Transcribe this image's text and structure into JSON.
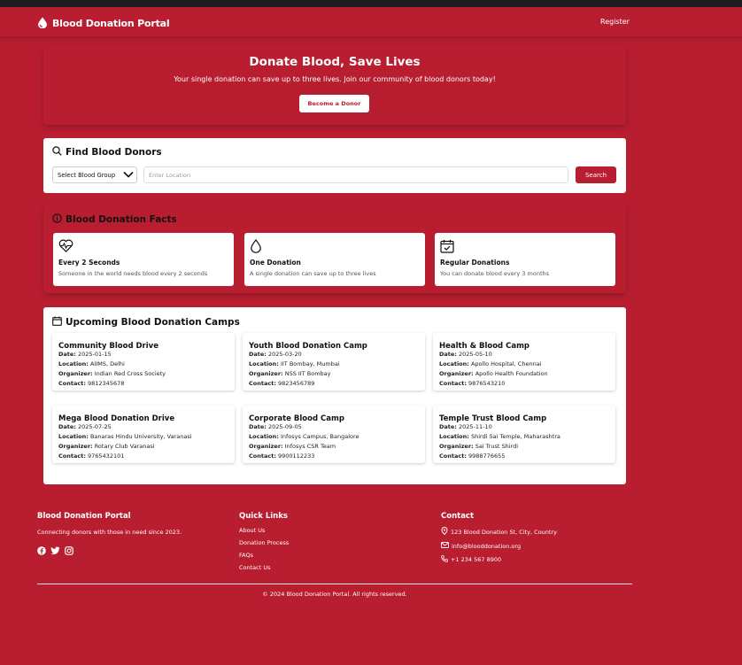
{
  "navbar": {
    "brand": "Blood Donation Portal",
    "register": "Register"
  },
  "hero": {
    "title": "Donate Blood, Save Lives",
    "subtitle": "Your single donation can save up to three lives. Join our community of blood donors today!",
    "button": "Become a Donor"
  },
  "search": {
    "title": "Find Blood Donors",
    "blood_group_selected": "Select Blood Group",
    "location_placeholder": "Enter Location",
    "button": "Search"
  },
  "facts": {
    "title": "Blood Donation Facts",
    "items": [
      {
        "icon": "heartbeat-icon",
        "title": "Every 2 Seconds",
        "desc": "Someone in the world needs blood every 2 seconds"
      },
      {
        "icon": "droplet-icon",
        "title": "One Donation",
        "desc": "A single donation can save up to three lives"
      },
      {
        "icon": "calendar-check-icon",
        "title": "Regular Donations",
        "desc": "You can donate blood every 3 months"
      }
    ]
  },
  "camps": {
    "title": "Upcoming Blood Donation Camps",
    "labels": {
      "date": "Date:",
      "location": "Location:",
      "organizer": "Organizer:",
      "contact": "Contact:"
    },
    "items": [
      {
        "name": "Community Blood Drive",
        "date": "2025-01-15",
        "location": "AIIMS, Delhi",
        "organizer": "Indian Red Cross Society",
        "contact": "9812345678"
      },
      {
        "name": "Youth Blood Donation Camp",
        "date": "2025-03-20",
        "location": "IIT Bombay, Mumbai",
        "organizer": "NSS IIT Bombay",
        "contact": "9823456789"
      },
      {
        "name": "Health & Blood Camp",
        "date": "2025-05-10",
        "location": "Apollo Hospital, Chennai",
        "organizer": "Apollo Health Foundation",
        "contact": "9876543210"
      },
      {
        "name": "Mega Blood Donation Drive",
        "date": "2025-07-25",
        "location": "Banaras Hindu University, Varanasi",
        "organizer": "Rotary Club Varanasi",
        "contact": "9765432101"
      },
      {
        "name": "Corporate Blood Camp",
        "date": "2025-09-05",
        "location": "Infosys Campus, Bangalore",
        "organizer": "Infosys CSR Team",
        "contact": "9900112233"
      },
      {
        "name": "Temple Trust Blood Camp",
        "date": "2025-11-10",
        "location": "Shirdi Sai Temple, Maharashtra",
        "organizer": "Sai Trust Shirdi",
        "contact": "9988776655"
      }
    ]
  },
  "footer": {
    "about_title": "Blood Donation Portal",
    "tagline": "Connecting donors with those in need since 2023.",
    "links_title": "Quick Links",
    "links": [
      "About Us",
      "Donation Process",
      "FAQs",
      "Contact Us"
    ],
    "contact_title": "Contact",
    "address": "123 Blood Donation St, City, Country",
    "email": "info@blooddonation.org",
    "phone": "+1 234 567 8900",
    "copyright": "© 2024 Blood Donation Portal. All rights reserved."
  },
  "colors": {
    "primary": "#b91e30",
    "surface": "#ffffff",
    "text": "#111111"
  }
}
